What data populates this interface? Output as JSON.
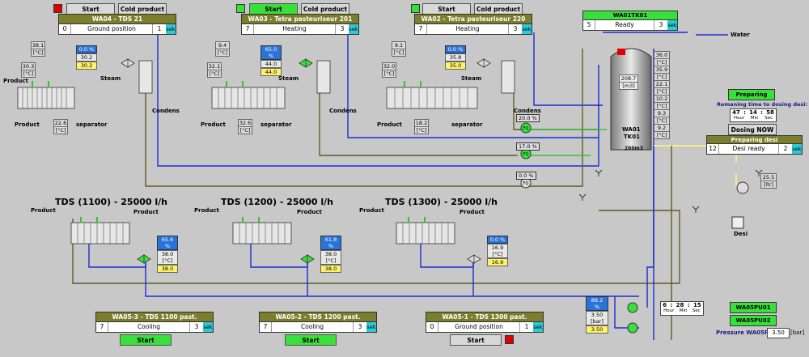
{
  "colors": {
    "pipe_blue": "#1d2bd4",
    "pipe_olive": "#5c5c25",
    "pipe_green": "#33c233",
    "pipe_yellow": "#f4ef8a",
    "panel_header": "#7d7d2e",
    "active_green": "#39e03c",
    "alarm_red": "#e00000",
    "unit_cyan": "#2ec8d8"
  },
  "top_units": [
    {
      "start_label": "Start",
      "cold_label": "Cold product",
      "title": "WA04 - TDS 21",
      "step": "0",
      "status": "Ground position",
      "time": "1",
      "unit": "sek",
      "t_prod_in": "38.1",
      "t_heat": "30.3",
      "t_out": "22.6",
      "valve_pct": "0.0",
      "valve_unit": "%",
      "t_hot": "30.2",
      "t_setp": "30.2",
      "cel": "[°C]"
    },
    {
      "start_label": "Start",
      "cold_label": "Cold product",
      "title": "WA03 - Tetra pasteuriseur 201",
      "step": "7",
      "status": "Heating",
      "time": "3",
      "unit": "sek",
      "t_prod_in": "9.4",
      "t_heat": "32.1",
      "t_out": "32.6",
      "valve_pct": "65.0",
      "valve_unit": "%",
      "t_hot": "44.0",
      "t_setp": "44.0",
      "cel": "[°C]"
    },
    {
      "start_label": "Start",
      "cold_label": "Cold product",
      "title": "WA02 - Tetra pasteuriseur 220",
      "step": "7",
      "status": "Heating",
      "time": "3",
      "unit": "sek",
      "t_prod_in": "9.1",
      "t_heat": "32.0",
      "t_out": "18.2",
      "valve_pct": "0.0",
      "valve_unit": "%",
      "t_hot": "35.8",
      "t_setp": "35.0",
      "cel": "[°C]"
    }
  ],
  "labels": {
    "product": "Product",
    "steam": "Steam",
    "condens": "Condens",
    "separator": "separator",
    "water": "Water",
    "desi": "Desi"
  },
  "tank": {
    "title": "WA01TK01",
    "step": "5",
    "status": "Ready",
    "time": "3",
    "unit": "sek",
    "volume": "208.7",
    "volume_unit": "[m3]",
    "name": "WA01",
    "tag": "TK01",
    "capacity": "200m3",
    "temps": [
      "36.0",
      "35.9",
      "22.1",
      "10.2",
      "9.3",
      "9.2"
    ],
    "cel": "[°C]"
  },
  "flows": [
    {
      "pct": "20.0",
      "unit": "%",
      "icon": "FQ"
    },
    {
      "pct": "17.0",
      "unit": "%",
      "icon": "FQ"
    },
    {
      "pct": "0.0",
      "unit": "%",
      "icon": "FQ"
    }
  ],
  "desi": {
    "preparing_label": "Preparing",
    "remaining_label": "Remaning time to dosing desi:",
    "hours": "47",
    "minutes": "14",
    "seconds": "58",
    "h_lbl": "Hour",
    "m_lbl": "Min",
    "s_lbl": "Sec",
    "dosing_label": "Dosing NOW",
    "prep_title": "Preparing desi",
    "step": "12",
    "status": "Desi ready",
    "time": "2",
    "unit": "sek",
    "level": "25.5",
    "level_unit": "[ltr]"
  },
  "tds_units": [
    {
      "header": "TDS  (1100) - 25000 l/h",
      "title": "WA05-3 - TDS 1100 past.",
      "step": "7",
      "status": "Cooling",
      "time": "3",
      "unit": "sek",
      "valve_pct": "65.6",
      "valve_unit": "%",
      "t_val": "38.0",
      "t_setp": "38.0",
      "cel": "[°C]",
      "start_label": "Start"
    },
    {
      "header": "TDS (1200) - 25000 l/h",
      "title": "WA05-2 - TDS 1200 past.",
      "step": "7",
      "status": "Cooling",
      "time": "3",
      "unit": "sek",
      "valve_pct": "61.8",
      "valve_unit": "%",
      "t_val": "38.0",
      "t_setp": "38.0",
      "cel": "[°C]",
      "start_label": "Start"
    },
    {
      "header": "TDS (1300) - 25000 l/h",
      "title": "WA05-1 - TDS 1300 past.",
      "step": "0",
      "status": "Ground position",
      "time": "1",
      "unit": "sek",
      "valve_pct": "0.0",
      "valve_unit": "%",
      "t_val": "16.9",
      "t_setp": "16.9",
      "cel": "[°C]",
      "start_label": "Start"
    }
  ],
  "pump": {
    "pct": "88.2",
    "unit": "%",
    "pressure": "3.50",
    "p_unit": "[bar]",
    "setp": "3.50"
  },
  "timer": {
    "hours": "6",
    "minutes": "28",
    "seconds": "15",
    "h_lbl": "Hour",
    "m_lbl": "Min",
    "s_lbl": "Sec"
  },
  "pumps": {
    "p1": "WA05PU01",
    "p2": "WA05PU02",
    "pressure_label": "Pressure WA05PT01:",
    "pressure_value": "3.50",
    "pressure_unit": "[bar]"
  }
}
